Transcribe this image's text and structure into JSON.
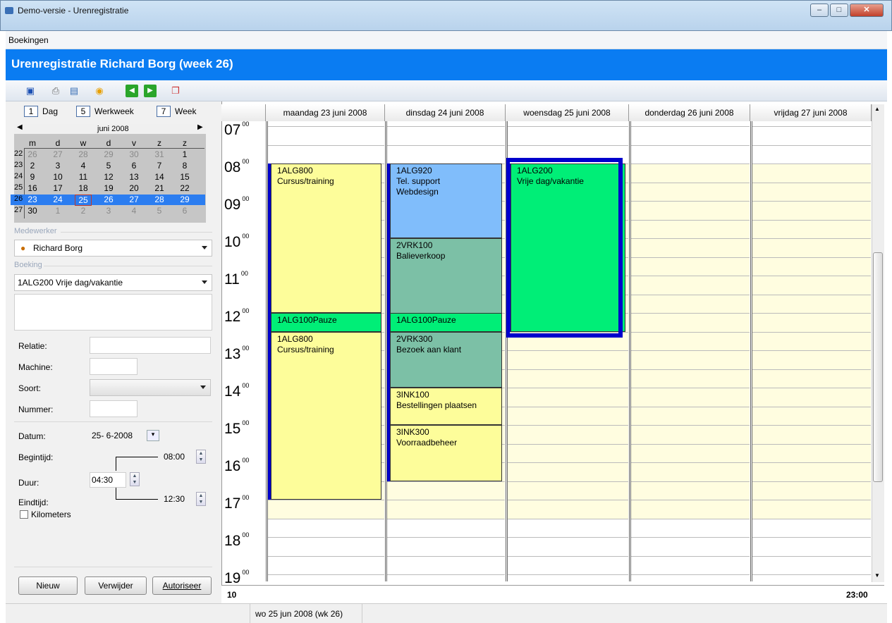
{
  "window": {
    "title": "Demo-versie - Urenregistratie"
  },
  "menu": [
    "Boekingen"
  ],
  "header": {
    "title": "Urenregistratie Richard Borg (week 26)"
  },
  "toolbar_icons": [
    "save-icon",
    "print-icon",
    "print-preview-icon",
    "timer-icon",
    "previous-week-icon",
    "next-week-icon",
    "new-window-icon"
  ],
  "views": [
    {
      "key": "1",
      "label": "Dag"
    },
    {
      "key": "5",
      "label": "Werkweek"
    },
    {
      "key": "7",
      "label": "Week"
    }
  ],
  "calendar": {
    "month": "juni 2008",
    "weekdays": [
      "m",
      "d",
      "w",
      "d",
      "v",
      "z",
      "z"
    ],
    "weeks": [
      {
        "wk": "22",
        "days": [
          "26",
          "27",
          "28",
          "29",
          "30",
          "31",
          "1"
        ]
      },
      {
        "wk": "23",
        "days": [
          "2",
          "3",
          "4",
          "5",
          "6",
          "7",
          "8"
        ]
      },
      {
        "wk": "24",
        "days": [
          "9",
          "10",
          "11",
          "12",
          "13",
          "14",
          "15"
        ]
      },
      {
        "wk": "25",
        "days": [
          "16",
          "17",
          "18",
          "19",
          "20",
          "21",
          "22"
        ]
      },
      {
        "wk": "26",
        "days": [
          "23",
          "24",
          "25",
          "26",
          "27",
          "28",
          "29"
        ]
      },
      {
        "wk": "27",
        "days": [
          "30",
          "1",
          "2",
          "3",
          "4",
          "5",
          "6"
        ]
      }
    ]
  },
  "form": {
    "medewerker_label": "Medewerker",
    "medewerker": "Richard Borg",
    "boeking_label": "Boeking",
    "boeking": "1ALG200 Vrije dag/vakantie",
    "relatie_label": "Relatie:",
    "machine_label": "Machine:",
    "soort_label": "Soort:",
    "nummer_label": "Nummer:",
    "datum_label": "Datum:",
    "datum": "25- 6-2008",
    "begintijd_label": "Begintijd:",
    "begintijd": "08:00",
    "duur_label": "Duur:",
    "duur": "04:30",
    "eindtijd_label": "Eindtijd:",
    "eindtijd": "12:30",
    "kilometers_label": "Kilometers"
  },
  "buttons": {
    "nieuw": "Nieuw",
    "verwijder": "Verwijder",
    "autoriseer": "Autoriseer"
  },
  "schedule": {
    "days": [
      "maandag 23 juni 2008",
      "dinsdag 24 juni 2008",
      "woensdag 25 juni 2008",
      "donderdag 26 juni 2008",
      "vrijdag 27 juni 2008"
    ],
    "hours": [
      "07",
      "08",
      "09",
      "10",
      "11",
      "12",
      "13",
      "14",
      "15",
      "16",
      "17",
      "18",
      "19"
    ],
    "minutes": "00",
    "footer_left": "10",
    "footer_right": "23:00"
  },
  "appointments": [
    {
      "day": 0,
      "start": 8.0,
      "end": 12.0,
      "code": "1ALG800",
      "desc": "Cursus/training",
      "color": "#fdfd9a"
    },
    {
      "day": 0,
      "start": 12.0,
      "end": 12.5,
      "code": "1ALG100Pauze",
      "desc": "",
      "color": "#00ee77"
    },
    {
      "day": 0,
      "start": 12.5,
      "end": 17.0,
      "code": "1ALG800",
      "desc": "Cursus/training",
      "color": "#fdfd9a"
    },
    {
      "day": 1,
      "start": 8.0,
      "end": 10.0,
      "code": "1ALG920",
      "desc": "Tel. support",
      "desc2": "Webdesign",
      "color": "#80bdfb"
    },
    {
      "day": 1,
      "start": 10.0,
      "end": 12.5,
      "code": "2VRK100",
      "desc": "Balieverkoop",
      "color": "#7cc0a6"
    },
    {
      "day": 1,
      "start": 12.0,
      "end": 12.5,
      "code": "1ALG100Pauze",
      "desc": "",
      "color": "#00ee77"
    },
    {
      "day": 1,
      "start": 12.5,
      "end": 14.0,
      "code": "2VRK300",
      "desc": "Bezoek aan klant",
      "color": "#7cc0a6"
    },
    {
      "day": 1,
      "start": 14.0,
      "end": 15.0,
      "code": "3INK100",
      "desc": "Bestellingen plaatsen",
      "color": "#fdfd9a"
    },
    {
      "day": 1,
      "start": 15.0,
      "end": 16.5,
      "code": "3INK300",
      "desc": "Voorraadbeheer",
      "color": "#fdfd9a"
    },
    {
      "day": 2,
      "start": 8.0,
      "end": 12.5,
      "code": "1ALG200",
      "desc": "Vrije dag/vakantie",
      "color": "#00ee77"
    }
  ],
  "statusbar": {
    "text": "wo 25 jun 2008 (wk 26)"
  }
}
